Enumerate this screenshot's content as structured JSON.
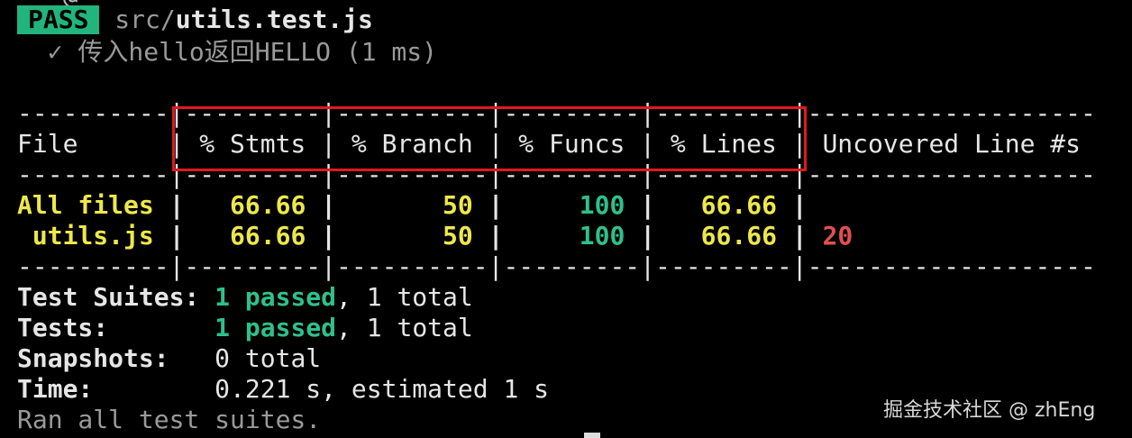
{
  "terminal": {
    "top_cut_text": "···@··· ······ ····· ·····  ·· ······ ···",
    "pass_label": "PASS",
    "file_prefix": "src/",
    "file_name": "utils.test.js",
    "test_case": "  ✓ 传入hello返回HELLO (1 ms)",
    "coverage_table": {
      "sep_top": "----------|---------|----------|---------|---------|-------------------",
      "header_row": "File      | % Stmts | % Branch | % Funcs | % Lines | Uncovered Line #s",
      "sep_mid": "----------|---------|----------|---------|---------|-------------------",
      "rows": [
        {
          "file": "All files",
          "stmts": "66.66",
          "branch": "50",
          "funcs": "100",
          "lines": "66.66",
          "uncovered": ""
        },
        {
          "file": " utils.js",
          "stmts": "66.66",
          "branch": "50",
          "funcs": "100",
          "lines": "66.66",
          "uncovered": "20"
        }
      ],
      "sep_bottom": "----------|---------|----------|---------|---------|-------------------"
    },
    "summary": {
      "suites_label": "Test Suites:",
      "suites_passed": "1 passed",
      "suites_total": ", 1 total",
      "tests_label": "Tests:",
      "tests_passed": "1 passed",
      "tests_total": ", 1 total",
      "snapshots_label": "Snapshots:",
      "snapshots_value": "0 total",
      "time_label": "Time:",
      "time_value": "0.221 s, estimated 1 s",
      "ran_all": "Ran all test suites."
    },
    "watermark": "掘金技术社区 @ zhEng",
    "colors": {
      "background": "#000000",
      "pass_badge": "#21b57d",
      "yellow": "#ede84a",
      "green": "#2ec08f",
      "red": "#e2504f",
      "highlight_box": "#e0191c"
    }
  }
}
